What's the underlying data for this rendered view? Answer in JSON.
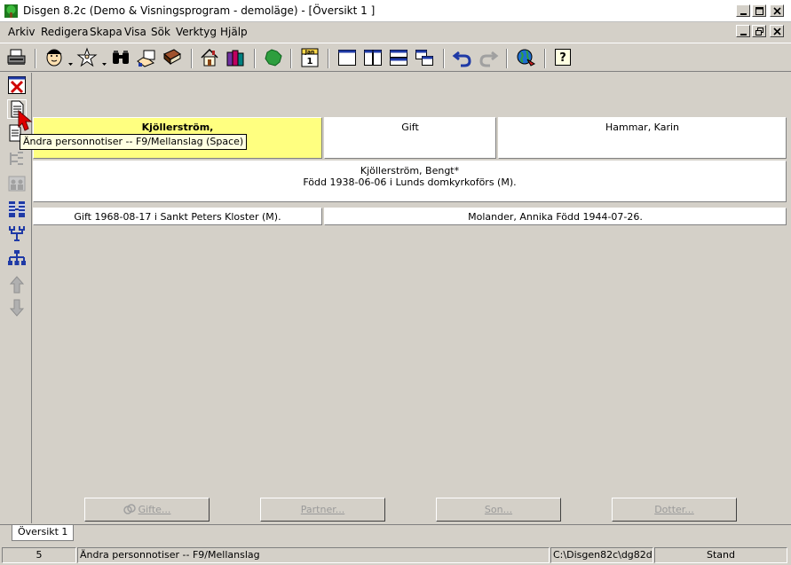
{
  "window": {
    "title": "Disgen 8.2c (Demo & Visningsprogram - demoläge) - [Översikt 1 ]"
  },
  "menu": {
    "items": [
      "Arkiv",
      "Redigera",
      "Skapa",
      "Visa",
      "Sök",
      "Verktyg",
      "Hjälp"
    ]
  },
  "toolbar": {
    "calendar_icon_text": "Jan\n1",
    "help_icon_text": "?"
  },
  "tooltip": "Ändra personnotiser -- F9/Mellanslag (Space)",
  "overview": {
    "person_name": "Kjöllerström,",
    "parents_relation": "Gift",
    "partner_parent": "Hammar, Karin",
    "focus_person": "Kjöllerström, Bengt*",
    "focus_birth": "Född 1938-06-06 i Lunds domkyrkoförs (M).",
    "marriage": "Gift 1968-08-17 i Sankt Peters Kloster (M).",
    "spouse": "Molander, Annika Född 1944-07-26."
  },
  "bottom_buttons": {
    "gifte": "Gifte...",
    "partner": "Partner...",
    "son": "Son...",
    "dotter": "Dotter..."
  },
  "tabs": [
    "Översikt 1"
  ],
  "statusbar": {
    "count": "5",
    "message": "Ändra personnotiser -- F9/Mellanslag",
    "path": "C:\\Disgen82c\\dg82data",
    "mode": "Stand"
  },
  "colors": {
    "highlight_cell": "#ffff80",
    "tooltip_bg": "#ffffe1",
    "face": "#d4d0c8",
    "toolbar_blue": "#1f3aa6"
  }
}
